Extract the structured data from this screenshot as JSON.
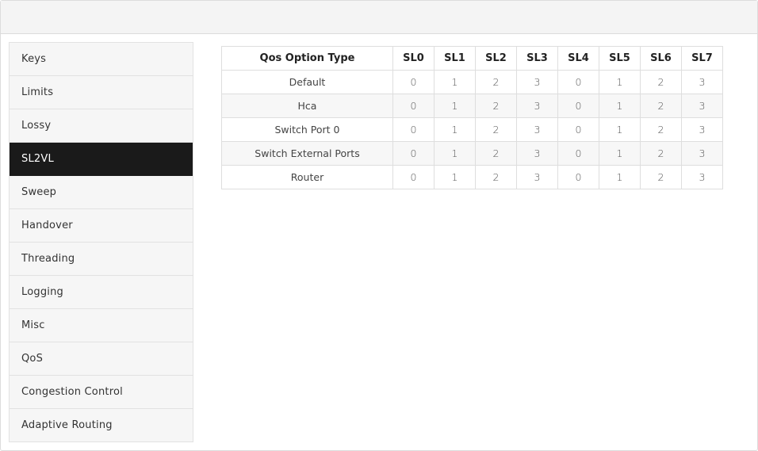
{
  "sidebar": {
    "items": [
      {
        "label": "Keys",
        "active": false
      },
      {
        "label": "Limits",
        "active": false
      },
      {
        "label": "Lossy",
        "active": false
      },
      {
        "label": "SL2VL",
        "active": true
      },
      {
        "label": "Sweep",
        "active": false
      },
      {
        "label": "Handover",
        "active": false
      },
      {
        "label": "Threading",
        "active": false
      },
      {
        "label": "Logging",
        "active": false
      },
      {
        "label": "Misc",
        "active": false
      },
      {
        "label": "QoS",
        "active": false
      },
      {
        "label": "Congestion Control",
        "active": false
      },
      {
        "label": "Adaptive Routing",
        "active": false
      }
    ]
  },
  "table": {
    "headers": [
      "Qos Option Type",
      "SL0",
      "SL1",
      "SL2",
      "SL3",
      "SL4",
      "SL5",
      "SL6",
      "SL7"
    ],
    "rows": [
      {
        "type": "Default",
        "values": [
          "0",
          "1",
          "2",
          "3",
          "0",
          "1",
          "2",
          "3"
        ]
      },
      {
        "type": "Hca",
        "values": [
          "0",
          "1",
          "2",
          "3",
          "0",
          "1",
          "2",
          "3"
        ]
      },
      {
        "type": "Switch Port 0",
        "values": [
          "0",
          "1",
          "2",
          "3",
          "0",
          "1",
          "2",
          "3"
        ]
      },
      {
        "type": "Switch External Ports",
        "values": [
          "0",
          "1",
          "2",
          "3",
          "0",
          "1",
          "2",
          "3"
        ]
      },
      {
        "type": "Router",
        "values": [
          "0",
          "1",
          "2",
          "3",
          "0",
          "1",
          "2",
          "3"
        ]
      }
    ]
  }
}
